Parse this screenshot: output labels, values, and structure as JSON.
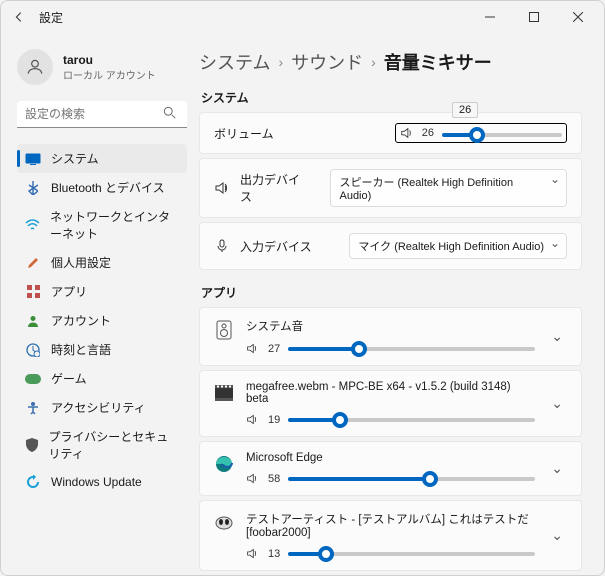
{
  "window": {
    "title": "設定"
  },
  "user": {
    "name": "tarou",
    "sub": "ローカル アカウント"
  },
  "search": {
    "placeholder": "設定の検索"
  },
  "nav": [
    {
      "icon": "display",
      "label": "システム",
      "color": "#0067c0",
      "selected": true
    },
    {
      "icon": "bluetooth",
      "label": "Bluetooth とデバイス",
      "color": "#316bb3"
    },
    {
      "icon": "wifi",
      "label": "ネットワークとインターネット",
      "color": "#1aa0d8"
    },
    {
      "icon": "brush",
      "label": "個人用設定",
      "color": "#d06a3a"
    },
    {
      "icon": "apps",
      "label": "アプリ",
      "color": "#c0504d"
    },
    {
      "icon": "account",
      "label": "アカウント",
      "color": "#3a8f3a"
    },
    {
      "icon": "time",
      "label": "時刻と言語",
      "color": "#2a6fb0"
    },
    {
      "icon": "game",
      "label": "ゲーム",
      "color": "#4a9a5a"
    },
    {
      "icon": "access",
      "label": "アクセシビリティ",
      "color": "#3a6fb0"
    },
    {
      "icon": "privacy",
      "label": "プライバシーとセキュリティ",
      "color": "#555"
    },
    {
      "icon": "update",
      "label": "Windows Update",
      "color": "#1aa0d8"
    }
  ],
  "breadcrumb": {
    "a": "システム",
    "b": "サウンド",
    "c": "音量ミキサー"
  },
  "system": {
    "label": "システム",
    "volumeLabel": "ボリューム",
    "volumeValue": "26",
    "tooltip": "26",
    "outputLabel": "出力デバイス",
    "outputValue": "スピーカー (Realtek High Definition Audio)",
    "inputLabel": "入力デバイス",
    "inputValue": "マイク (Realtek High Definition Audio)"
  },
  "appsLabel": "アプリ",
  "apps": [
    {
      "title": "システム音",
      "value": "27",
      "pct": 27,
      "icon": "sysaudio"
    },
    {
      "title": "megafree.webm - MPC-BE x64 - v1.5.2 (build 3148) beta",
      "value": "19",
      "pct": 19,
      "icon": "mpc"
    },
    {
      "title": "Microsoft Edge",
      "value": "58",
      "pct": 58,
      "icon": "edge"
    },
    {
      "title": "テストアーティスト - [テストアルバム] これはテストだ [foobar2000]",
      "value": "13",
      "pct": 13,
      "icon": "foobar"
    }
  ]
}
